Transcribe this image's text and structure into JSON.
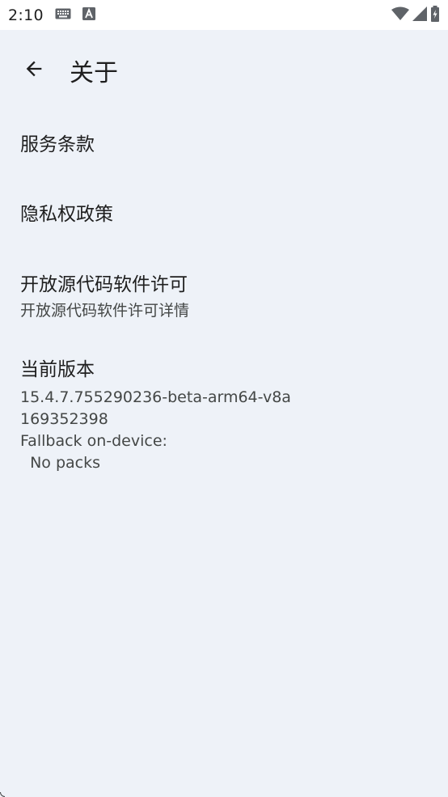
{
  "status_bar": {
    "time": "2:10",
    "icons": [
      "keyboard-icon",
      "font-a-icon",
      "wifi-icon",
      "cellular-signal-icon",
      "battery-charging-icon"
    ]
  },
  "app_bar": {
    "back_icon": "arrow-left-icon",
    "title": "关于"
  },
  "items": [
    {
      "title": "服务条款"
    },
    {
      "title": "隐私权政策"
    },
    {
      "title": "开放源代码软件许可",
      "subtitle": "开放源代码软件许可详情"
    }
  ],
  "version": {
    "title": "当前版本",
    "lines": [
      "15.4.7.755290236-beta-arm64-v8a",
      "169352398",
      "Fallback on-device:",
      "  No packs"
    ]
  },
  "colors": {
    "background": "#eef2f8",
    "status_bar": "#ffffff",
    "text_primary": "#1f1f1f",
    "text_secondary": "#444746"
  }
}
